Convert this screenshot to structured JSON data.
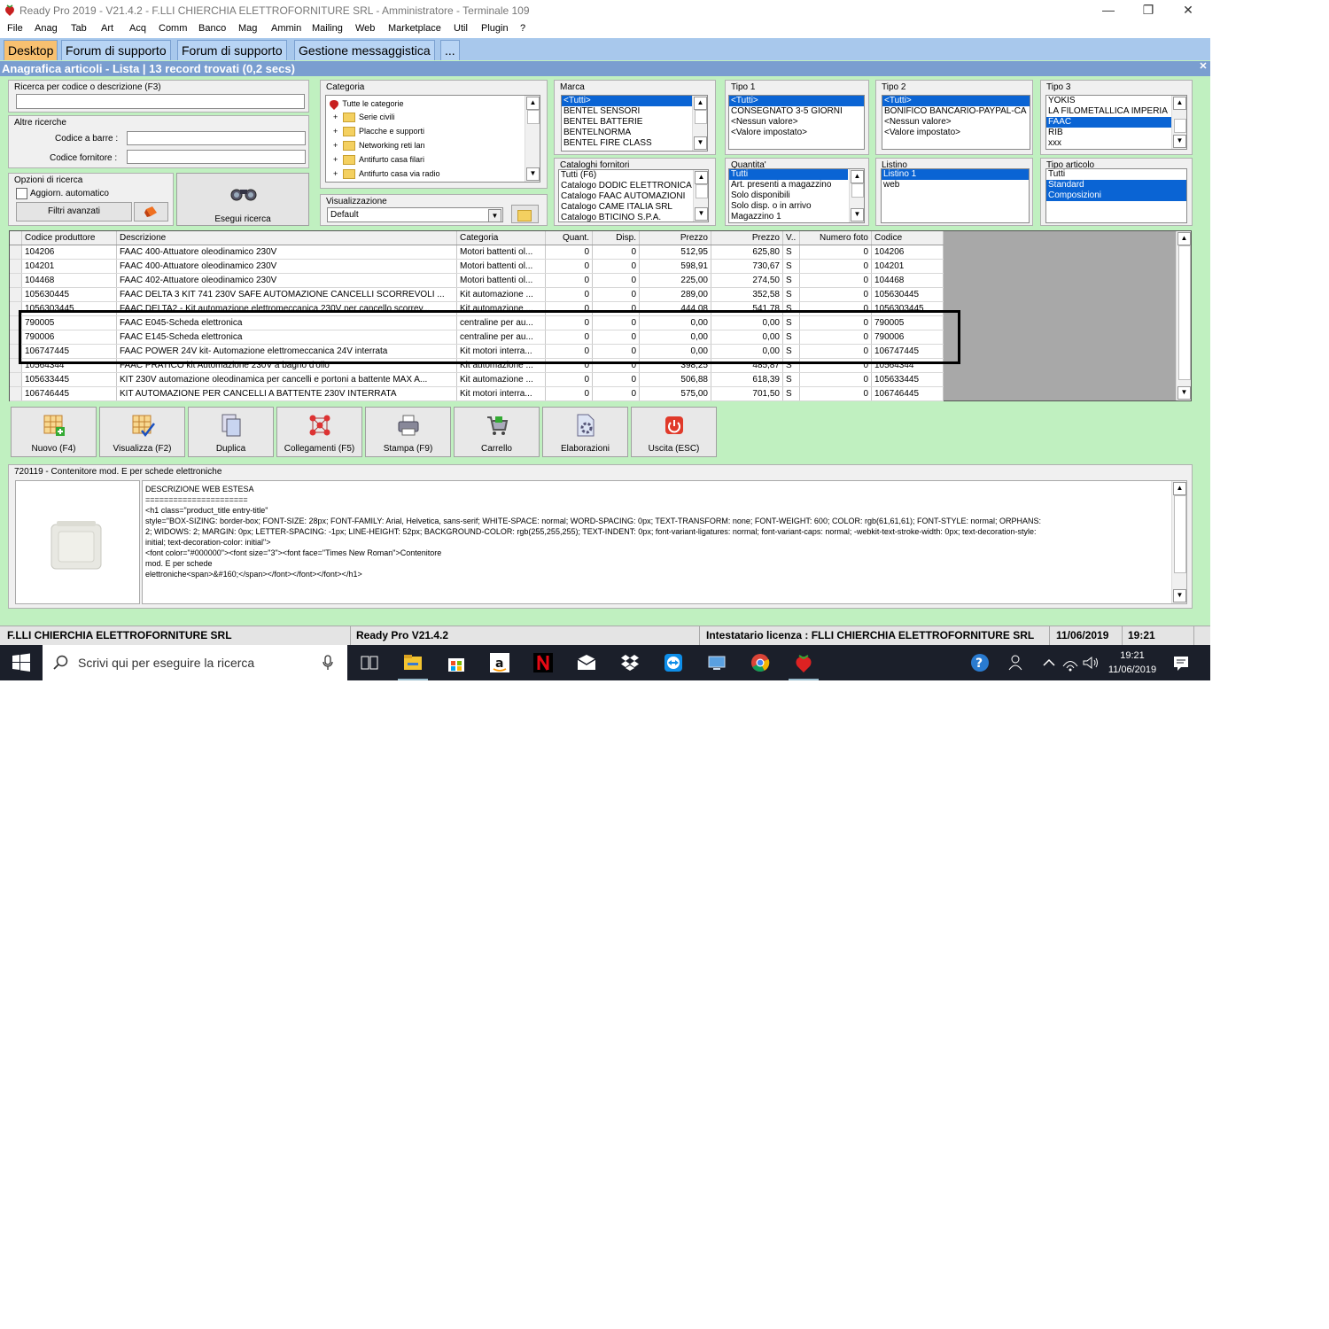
{
  "window": {
    "title": "Ready Pro 2019 - V21.4.2 - F.LLI CHIERCHIA ELETTROFORNITURE SRL - Amministratore - Terminale 109",
    "minimize": "—",
    "maximize": "❐",
    "close": "✕"
  },
  "menu": [
    "File",
    "Anag",
    "Tab",
    "Art",
    "Acq",
    "Comm",
    "Banco",
    "Mag",
    "Ammin",
    "Mailing",
    "Web",
    "Marketplace",
    "Util",
    "Plugin",
    "?"
  ],
  "tabs": [
    "Desktop",
    "Forum di supporto",
    "Forum di supporto",
    "Gestione messaggistica",
    "..."
  ],
  "header": {
    "title": "Anagrafica articoli  - Lista | 13 record trovati (0,2 secs)",
    "close": "✕"
  },
  "search": {
    "group_label": "Ricerca per codice o descrizione (F3)",
    "search_value": "",
    "other_label": "Altre ricerche",
    "barcode_label": "Codice a barre :",
    "supplier_code_label": "Codice fornitore :",
    "options_label": "Opzioni di ricerca",
    "auto_update_label": "Aggiorn. automatico",
    "advanced_filters": "Filtri avanzati",
    "execute_search": "Esegui ricerca"
  },
  "categoria": {
    "label": "Categoria",
    "nodes": [
      "Tutte le categorie",
      "Serie civili",
      "Placche e supporti",
      "Networking reti lan",
      "Antifurto casa filari",
      "Antifurto casa via radio"
    ]
  },
  "visualizzazione": {
    "label": "Visualizzazione",
    "value": "Default"
  },
  "marca": {
    "label": "Marca",
    "items": [
      "<Tutti>",
      "BENTEL SENSORI",
      "BENTEL BATTERIE",
      "BENTELNORMA",
      "BENTEL FIRE CLASS"
    ],
    "selected": 0
  },
  "tipo1": {
    "label": "Tipo 1",
    "items": [
      "<Tutti>",
      "CONSEGNATO 3-5 GIORNI",
      "<Nessun valore>",
      "<Valore impostato>"
    ],
    "selected": 0
  },
  "tipo2": {
    "label": "Tipo 2",
    "items": [
      "<Tutti>",
      "BONIFICO BANCARIO-PAYPAL-CA",
      "<Nessun valore>",
      "<Valore impostato>"
    ],
    "selected": 0
  },
  "tipo3": {
    "label": "Tipo 3",
    "items": [
      "YOKIS",
      "LA FILOMETALLICA IMPERIA",
      "FAAC",
      "RIB",
      "xxx"
    ],
    "selected": 2
  },
  "cataloghi": {
    "label": "Cataloghi fornitori",
    "items": [
      "Tutti (F6)",
      "Catalogo DODIC ELETTRONICA",
      "Catalogo FAAC AUTOMAZIONI",
      "Catalogo CAME ITALIA SRL",
      "Catalogo BTICINO S.P.A."
    ],
    "selected": -1
  },
  "quantita": {
    "label": "Quantita'",
    "items": [
      "Tutti",
      "Art. presenti a magazzino",
      "Solo disponibili",
      "Solo disp. o in arrivo",
      "Magazzino 1"
    ],
    "selected": 0
  },
  "listino": {
    "label": "Listino",
    "items": [
      "Listino 1",
      "web"
    ],
    "selected": 0
  },
  "tipo_articolo": {
    "label": "Tipo articolo",
    "items": [
      "Tutti",
      "Standard",
      "Composizioni"
    ],
    "selected_multi": [
      1,
      2
    ]
  },
  "grid": {
    "columns": [
      "Codice produttore",
      "Descrizione",
      "Categoria",
      "Quant.",
      "Disp.",
      "Prezzo",
      "Prezzo",
      "V..",
      "Numero foto",
      "Codice"
    ],
    "rows": [
      [
        "104206",
        "FAAC 400-Attuatore oleodinamico 230V",
        "Motori battenti ol...",
        "0",
        "0",
        "512,95",
        "625,80",
        "S",
        "0",
        "104206"
      ],
      [
        "104201",
        "FAAC 400-Attuatore oleodinamico 230V",
        "Motori battenti ol...",
        "0",
        "0",
        "598,91",
        "730,67",
        "S",
        "0",
        "104201"
      ],
      [
        "104468",
        "FAAC 402-Attuatore oleodinamico 230V",
        "Motori battenti ol...",
        "0",
        "0",
        "225,00",
        "274,50",
        "S",
        "0",
        "104468"
      ],
      [
        "105630445",
        "FAAC DELTA 3 KIT 741 230V SAFE AUTOMAZIONE CANCELLI SCORREVOLI ...",
        "Kit automazione ...",
        "0",
        "0",
        "289,00",
        "352,58",
        "S",
        "0",
        "105630445"
      ],
      [
        "1056303445",
        "FAAC DELTA2 - Kit automazione elettromeccanica 230V per cancello scorrev...",
        "Kit automazione ...",
        "0",
        "0",
        "444,08",
        "541,78",
        "S",
        "0",
        "1056303445"
      ],
      [
        "790005",
        "FAAC E045-Scheda elettronica",
        "centraline per au...",
        "0",
        "0",
        "0,00",
        "0,00",
        "S",
        "0",
        "790005"
      ],
      [
        "790006",
        "FAAC E145-Scheda elettronica",
        "centraline per au...",
        "0",
        "0",
        "0,00",
        "0,00",
        "S",
        "0",
        "790006"
      ],
      [
        "106747445",
        "FAAC POWER 24V kit- Automazione elettromeccanica 24V interrata",
        "Kit motori interra...",
        "0",
        "0",
        "0,00",
        "0,00",
        "S",
        "0",
        "106747445"
      ],
      [
        "10564344",
        "FAAC PRATICO kit Automazione 230V a bagno d'olio",
        "Kit automazione ...",
        "0",
        "0",
        "398,25",
        "485,87",
        "S",
        "0",
        "10564344"
      ],
      [
        "105633445",
        "KIT 230V automazione oleodinamica per cancelli e portoni a battente MAX A...",
        "Kit automazione ...",
        "0",
        "0",
        "506,88",
        "618,39",
        "S",
        "0",
        "105633445"
      ],
      [
        "106746445",
        "KIT AUTOMAZIONE PER CANCELLI A BATTENTE 230V INTERRATA",
        "Kit motori interra...",
        "0",
        "0",
        "575,00",
        "701,50",
        "S",
        "0",
        "106746445"
      ]
    ]
  },
  "toolbar": [
    "Nuovo (F4)",
    "Visualizza (F2)",
    "Duplica",
    "Collegamenti (F5)",
    "Stampa (F9)",
    "Carrello",
    "Elaborazioni",
    "Uscita (ESC)"
  ],
  "detail": {
    "title": "720119 - Contenitore mod. E per schede elettroniche",
    "text_lines": [
      "DESCRIZIONE WEB ESTESA",
      "======================",
      "<h1 class=\"product_title entry-title\"",
      "style=\"BOX-SIZING: border-box; FONT-SIZE: 28px; FONT-FAMILY: Arial, Helvetica, sans-serif; WHITE-SPACE: normal; WORD-SPACING: 0px; TEXT-TRANSFORM: none; FONT-WEIGHT: 600; COLOR: rgb(61,61,61); FONT-STYLE: normal; ORPHANS:",
      "2; WIDOWS: 2; MARGIN: 0px; LETTER-SPACING: -1px; LINE-HEIGHT: 52px; BACKGROUND-COLOR: rgb(255,255,255); TEXT-INDENT: 0px; font-variant-ligatures: normal; font-variant-caps: normal; -webkit-text-stroke-width: 0px; text-decoration-style:",
      "initial; text-decoration-color: initial\">",
      "<font color=\"#000000\"><font size=\"3\"><font face=\"Times New Roman\">Contenitore",
      "mod. E per schede",
      "elettroniche<span>&#160;</span></font></font></font></h1>"
    ]
  },
  "status": {
    "company": "F.LLI CHIERCHIA ELETTROFORNITURE SRL",
    "version": "Ready Pro V21.4.2",
    "license": "Intestatario licenza : FLLI CHIERCHIA ELETTROFORNITURE SRL",
    "date": "11/06/2019",
    "time": "19:21"
  },
  "taskbar": {
    "search_placeholder": "Scrivi qui per eseguire la ricerca",
    "clock_time": "19:21",
    "clock_date": "11/06/2019"
  },
  "colors": {
    "app_bg": "#c0f0c0",
    "tab_active": "#f8c070",
    "header_blue": "#7a9ed0",
    "selection": "#0a64d4",
    "taskbar": "#1b1f2a"
  }
}
